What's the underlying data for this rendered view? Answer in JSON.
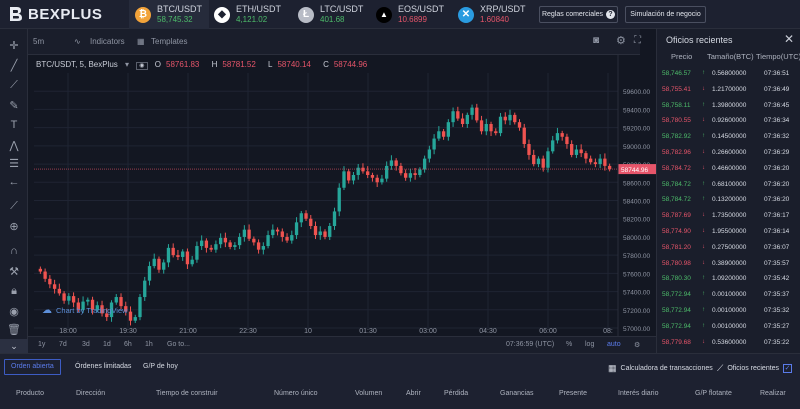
{
  "header": {
    "brand": "BEXPLUS",
    "tickers": [
      {
        "pair": "BTC/USDT",
        "price": "58,745.32",
        "trend": "up",
        "icon": "bitcoin-icon",
        "color": "#f2a33a",
        "glyph": "₿"
      },
      {
        "pair": "ETH/USDT",
        "price": "4,121.02",
        "trend": "up",
        "icon": "ethereum-icon",
        "color": "#ffffff",
        "glyph": "◆"
      },
      {
        "pair": "LTC/USDT",
        "price": "401.68",
        "trend": "up",
        "icon": "litecoin-icon",
        "color": "#b8bcc6",
        "glyph": "Ł"
      },
      {
        "pair": "EOS/USDT",
        "price": "10.6899",
        "trend": "down",
        "icon": "eos-icon",
        "color": "#000000",
        "glyph": "▲"
      },
      {
        "pair": "XRP/USDT",
        "price": "1.60840",
        "trend": "down",
        "icon": "xrp-icon",
        "color": "#2a9be0",
        "glyph": "✕"
      }
    ],
    "rules_button": "Reglas comerciales",
    "sim_button": "Simulación de negocio"
  },
  "chart_header": {
    "interval": "5m",
    "indicators": "Indicators",
    "templates": "Templates"
  },
  "legend": {
    "symbol": "BTC/USDT, 5, BexPlus",
    "open_label": "O",
    "open": "58761.83",
    "high_label": "H",
    "high": "58781.52",
    "low_label": "L",
    "low": "58740.14",
    "close_label": "C",
    "close": "58744.96"
  },
  "watermark": "Chart by TradingView",
  "bottom_bar": {
    "ranges": [
      "1y",
      "7d",
      "3d",
      "1d",
      "6h",
      "1h"
    ],
    "goto": "Go to...",
    "clock": "07:36:59 (UTC)",
    "percent": "%",
    "log": "log",
    "auto": "auto"
  },
  "chart_data": {
    "type": "candlestick",
    "title": "BTC/USDT, 5, BexPlus",
    "current_price": 58744.96,
    "ylim": [
      57000,
      59800
    ],
    "y_ticks": [
      59600,
      59400,
      59200,
      59000,
      58800,
      58600,
      58400,
      58200,
      58000,
      57800,
      57600,
      57400,
      57200,
      57000
    ],
    "x_ticks": [
      "18:00",
      "19:30",
      "21:00",
      "22:30",
      "10",
      "01:30",
      "03:00",
      "04:30",
      "06:00",
      "08:"
    ],
    "colors": {
      "up": "#26a69a",
      "down": "#ef5350",
      "price_line": "#e6556a"
    },
    "candles_close": [
      57620,
      57540,
      57480,
      57430,
      57380,
      57300,
      57350,
      57280,
      57200,
      57290,
      57310,
      57200,
      57250,
      57160,
      57120,
      57280,
      57340,
      57240,
      57180,
      57080,
      57120,
      57340,
      57520,
      57680,
      57760,
      57640,
      57720,
      57880,
      57800,
      57780,
      57840,
      57700,
      57750,
      57900,
      57960,
      57880,
      57860,
      57920,
      57990,
      57940,
      57890,
      57910,
      58000,
      58080,
      57980,
      57940,
      57860,
      57900,
      58020,
      58080,
      58060,
      58000,
      57960,
      58020,
      58160,
      58260,
      58200,
      58120,
      58020,
      58060,
      58000,
      58120,
      58280,
      58540,
      58720,
      58620,
      58680,
      58760,
      58720,
      58680,
      58650,
      58600,
      58640,
      58780,
      58840,
      58780,
      58700,
      58650,
      58700,
      58680,
      58740,
      58860,
      58960,
      59080,
      59160,
      59100,
      59260,
      59380,
      59300,
      59240,
      59340,
      59420,
      59280,
      59160,
      59240,
      59160,
      59140,
      59320,
      59280,
      59340,
      59260,
      59200,
      59020,
      58900,
      58800,
      58860,
      58760,
      58940,
      59060,
      59140,
      59100,
      59020,
      58900,
      58960,
      58920,
      58860,
      58820,
      58800,
      58860,
      58780,
      58745
    ]
  },
  "panel": {
    "title": "Oficios recientes",
    "columns": [
      "Precio",
      "Tamaño(BTC)",
      "Tiempo(UTC)"
    ],
    "trades": [
      {
        "price": "58,746.57",
        "side": "up",
        "size": "0.56800000",
        "time": "07:36:51"
      },
      {
        "price": "58,755.41",
        "side": "down",
        "size": "1.21700000",
        "time": "07:36:49"
      },
      {
        "price": "58,758.11",
        "side": "up",
        "size": "1.39800000",
        "time": "07:36:45"
      },
      {
        "price": "58,780.55",
        "side": "down",
        "size": "0.92600000",
        "time": "07:36:34"
      },
      {
        "price": "58,782.92",
        "side": "up",
        "size": "0.14500000",
        "time": "07:36:32"
      },
      {
        "price": "58,782.96",
        "side": "down",
        "size": "0.26600000",
        "time": "07:36:29"
      },
      {
        "price": "58,784.72",
        "side": "down",
        "size": "0.46600000",
        "time": "07:36:20"
      },
      {
        "price": "58,784.72",
        "side": "up",
        "size": "0.68100000",
        "time": "07:36:20"
      },
      {
        "price": "58,784.72",
        "side": "up",
        "size": "0.13200000",
        "time": "07:36:20"
      },
      {
        "price": "58,787.69",
        "side": "down",
        "size": "1.73500000",
        "time": "07:36:17"
      },
      {
        "price": "58,774.90",
        "side": "down",
        "size": "1.95500000",
        "time": "07:36:14"
      },
      {
        "price": "58,781.20",
        "side": "down",
        "size": "0.27500000",
        "time": "07:36:07"
      },
      {
        "price": "58,780.98",
        "side": "down",
        "size": "0.38900000",
        "time": "07:35:57"
      },
      {
        "price": "58,780.30",
        "side": "up",
        "size": "1.09200000",
        "time": "07:35:42"
      },
      {
        "price": "58,772.94",
        "side": "up",
        "size": "0.00100000",
        "time": "07:35:37"
      },
      {
        "price": "58,772.94",
        "side": "up",
        "size": "0.00100000",
        "time": "07:35:32"
      },
      {
        "price": "58,772.94",
        "side": "up",
        "size": "0.00100000",
        "time": "07:35:27"
      },
      {
        "price": "58,779.68",
        "side": "down",
        "size": "0.53600000",
        "time": "07:35:22"
      }
    ]
  },
  "orders": {
    "tabs": [
      "Orden abierta",
      "Órdenes limitadas",
      "G/P de hoy"
    ],
    "calculator": "Calculadora de transacciones",
    "recent": "Oficios recientes",
    "columns": [
      "Producto",
      "Dirección",
      "Tiempo de construir",
      "Número único",
      "Volumen",
      "Abrir",
      "Pérdida",
      "Ganancias",
      "Presente",
      "Interés diario",
      "G/P flotante",
      "Realizar"
    ]
  }
}
